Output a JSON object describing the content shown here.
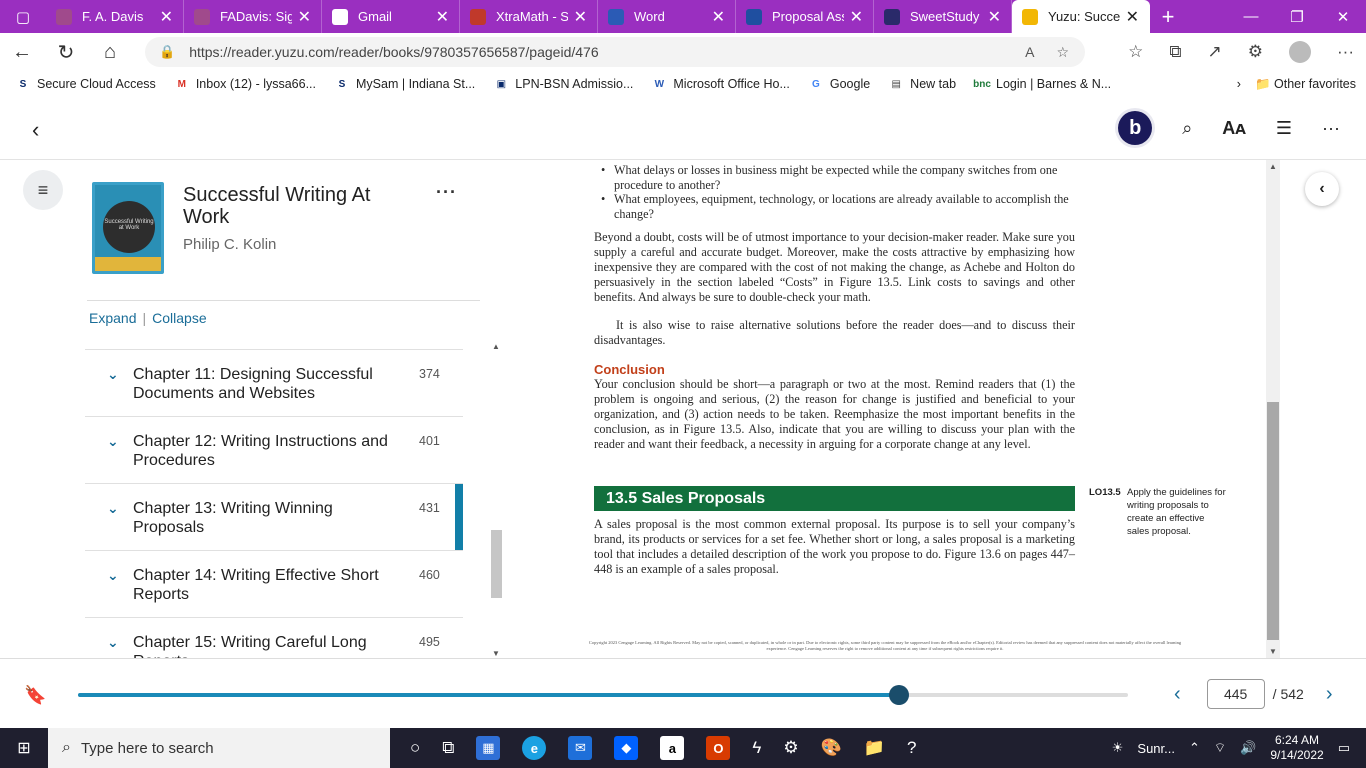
{
  "browser": {
    "tabs": [
      {
        "title": "F. A. Davis",
        "color": "#a04a8c"
      },
      {
        "title": "FADavis: Sign",
        "color": "#a04a8c"
      },
      {
        "title": "Gmail",
        "color": "#ffffff"
      },
      {
        "title": "XtraMath - St",
        "color": "#c0392b"
      },
      {
        "title": "Word",
        "color": "#2b5bb5"
      },
      {
        "title": "Proposal Assi",
        "color": "#1f4fa0"
      },
      {
        "title": "SweetStudy",
        "color": "#2a2a6a"
      },
      {
        "title": "Yuzu: Success",
        "color": "#f2b705"
      }
    ],
    "new_tab": "+",
    "url": "https://reader.yuzu.com/reader/books/9780357656587/pageid/476",
    "bookmarks": [
      {
        "label": "Secure Cloud Access",
        "icon": "S",
        "color": "#0a2a6b"
      },
      {
        "label": "Inbox (12) - lyssa66...",
        "icon": "M",
        "color": "#d93025"
      },
      {
        "label": "MySam | Indiana St...",
        "icon": "S",
        "color": "#0a2a6b"
      },
      {
        "label": "LPN-BSN Admissio...",
        "icon": "▣",
        "color": "#0a2a6b"
      },
      {
        "label": "Microsoft Office Ho...",
        "icon": "W",
        "color": "#2b5bb5"
      },
      {
        "label": "Google",
        "icon": "G",
        "color": "#4285f4"
      },
      {
        "label": "New tab",
        "icon": "▤",
        "color": "#444444"
      },
      {
        "label": "Login | Barnes & N...",
        "icon": "bnc",
        "color": "#1e7a3a"
      }
    ],
    "other_favorites": "Other favorites"
  },
  "reader": {
    "profile_initial": "b",
    "book": {
      "title": "Successful Writing At Work",
      "author": "Philip C. Kolin",
      "cover_text": "Successful Writing at Work"
    },
    "expand": "Expand",
    "collapse": "Collapse",
    "separator": "|",
    "chapters": [
      {
        "name": "Chapter 11: Designing Successful Documents and Websites",
        "page": "374"
      },
      {
        "name": "Chapter 12: Writing Instructions and Procedures",
        "page": "401"
      },
      {
        "name": "Chapter 13: Writing Winning Proposals",
        "page": "431"
      },
      {
        "name": "Chapter 14: Writing Effective Short Reports",
        "page": "460"
      },
      {
        "name": "Chapter 15: Writing Careful Long Reports",
        "page": "495"
      }
    ],
    "current_page": "445",
    "total_pages": "/ 542",
    "progress_fraction": 0.782
  },
  "page_content": {
    "bullet1": "What delays or losses in business might be expected while the company switches from one procedure to another?",
    "bullet2": "What employees, equipment, technology, or locations are already available to accomplish the change?",
    "para1": "Beyond a doubt, costs will be of utmost importance to your decision-maker reader. Make sure you supply a careful and accurate budget. Moreover, make the costs attractive by emphasizing how inexpensive they are compared with the cost of not making the change, as Achebe and Holton do persuasively in the section labeled “Costs” in Figure 13.5. Link costs to savings and other benefits. And always be sure to double-check your math.",
    "para2": "It is also wise to raise alternative solutions before the reader does—and to discuss their disadvantages.",
    "conclusion_head": "Conclusion",
    "conclusion": "Your conclusion should be short—a paragraph or two at the most. Remind readers that (1) the problem is ongoing and serious, (2) the reason for change is justified and beneficial to your organization, and (3) action needs to be taken. Reemphasize the most important benefits in the conclusion, as in Figure 13.5. Also, indicate that you are willing to discuss your plan with the reader and want their feedback, a necessity in arguing for a corporate change at any level.",
    "section_title": "13.5  Sales Proposals",
    "lo_code": "LO13.5",
    "lo_text": "Apply the guidelines for writing proposals to create an effective sales proposal.",
    "sales_para": "A sales proposal is the most common external proposal. Its purpose is to sell your company’s brand, its products or services for a set fee. Whether short or long, a sales proposal is a marketing tool that includes a detailed description of the work you propose to do. Figure 13.6 on pages 447–448 is an example of a sales proposal.",
    "copyright": "Copyright 2023 Cengage Learning. All Rights Reserved. May not be copied, scanned, or duplicated, in whole or in part. Due to electronic rights, some third party content may be suppressed from the eBook and/or eChapter(s). Editorial review has deemed that any suppressed content does not materially affect the overall learning experience. Cengage Learning reserves the right to remove additional content at any time if subsequent rights restrictions require it."
  },
  "taskbar": {
    "search_placeholder": "Type here to search",
    "weather": "Sunr...",
    "time": "6:24 AM",
    "date": "9/14/2022"
  }
}
